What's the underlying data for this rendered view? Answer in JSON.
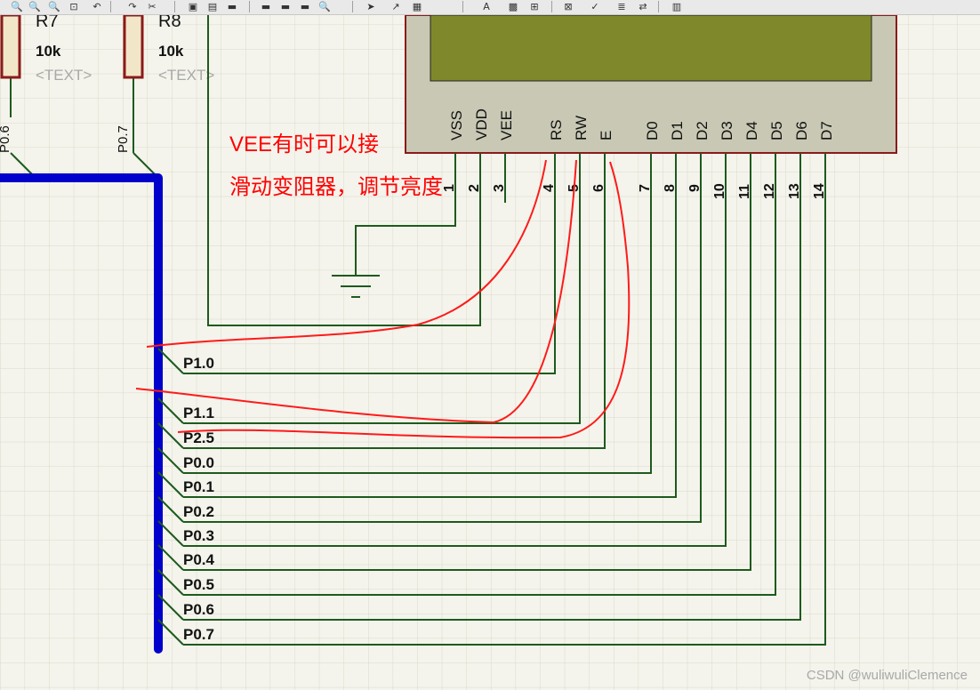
{
  "toolbar": {
    "buttons": [
      {
        "icon": "zoom-in-icon",
        "glyph": "🔍"
      },
      {
        "icon": "zoom-out-icon",
        "glyph": "🔍"
      },
      {
        "icon": "zoom-all-icon",
        "glyph": "🔍"
      },
      {
        "icon": "zoom-area-icon",
        "glyph": "⊡"
      },
      {
        "icon": "undo-icon",
        "glyph": "↶"
      },
      {
        "icon": "redo-icon",
        "glyph": "↷"
      },
      {
        "icon": "cut-icon",
        "glyph": "✂"
      },
      {
        "icon": "copy-icon",
        "glyph": "▣"
      },
      {
        "icon": "paste-icon",
        "glyph": "▤"
      },
      {
        "icon": "block-copy-icon",
        "glyph": "▬"
      },
      {
        "icon": "block-move-icon",
        "glyph": "▬"
      },
      {
        "icon": "block-rotate-icon",
        "glyph": "▬"
      },
      {
        "icon": "block-delete-icon",
        "glyph": "▬"
      },
      {
        "icon": "search-icon",
        "glyph": "🔍"
      },
      {
        "icon": "pick-device-icon",
        "glyph": "➤"
      },
      {
        "icon": "make-device-icon",
        "glyph": "↗"
      },
      {
        "icon": "package-tool-icon",
        "glyph": "▦"
      },
      {
        "icon": "property-assign-icon",
        "glyph": "A"
      },
      {
        "icon": "netlist-icon",
        "glyph": "▩"
      },
      {
        "icon": "new-sheet-icon",
        "glyph": "⊞"
      },
      {
        "icon": "remove-sheet-icon",
        "glyph": "⊠"
      },
      {
        "icon": "electrical-check-icon",
        "glyph": "✓"
      },
      {
        "icon": "bill-of-materials-icon",
        "glyph": "≣"
      },
      {
        "icon": "netlist-to-ares-icon",
        "glyph": "⇄"
      },
      {
        "icon": "ares-icon",
        "glyph": "▥"
      }
    ]
  },
  "resistors": [
    {
      "ref": "R7",
      "value": "10k",
      "text": "<TEXT>"
    },
    {
      "ref": "R8",
      "value": "10k",
      "text": "<TEXT>"
    }
  ],
  "left_labels": [
    "P0.6",
    "P0.7"
  ],
  "lcd": {
    "pin_names": [
      "VSS",
      "VDD",
      "VEE",
      "RS",
      "RW",
      "E",
      "D0",
      "D1",
      "D2",
      "D3",
      "D4",
      "D5",
      "D6",
      "D7"
    ],
    "pin_numbers": [
      "1",
      "2",
      "3",
      "4",
      "5",
      "6",
      "7",
      "8",
      "9",
      "10",
      "11",
      "12",
      "13",
      "14"
    ]
  },
  "net_labels": [
    "P1.0",
    "P1.1",
    "P2.5",
    "P0.0",
    "P0.1",
    "P0.2",
    "P0.3",
    "P0.4",
    "P0.5",
    "P0.6",
    "P0.7"
  ],
  "annotation": {
    "line1": "VEE有时可以接",
    "line2": "滑动变阻器，调节亮度"
  },
  "colors": {
    "wire": "#1e5a1e",
    "bus": "#0000cc",
    "component": "#8b1a1a",
    "lcd_body": "#c8c8b4",
    "lcd_screen": "#80882c",
    "annotation": "#ff0000",
    "grid": "#d9d9cc",
    "background": "#f4f4ec"
  },
  "watermark": "CSDN @wuliwuliClemence"
}
